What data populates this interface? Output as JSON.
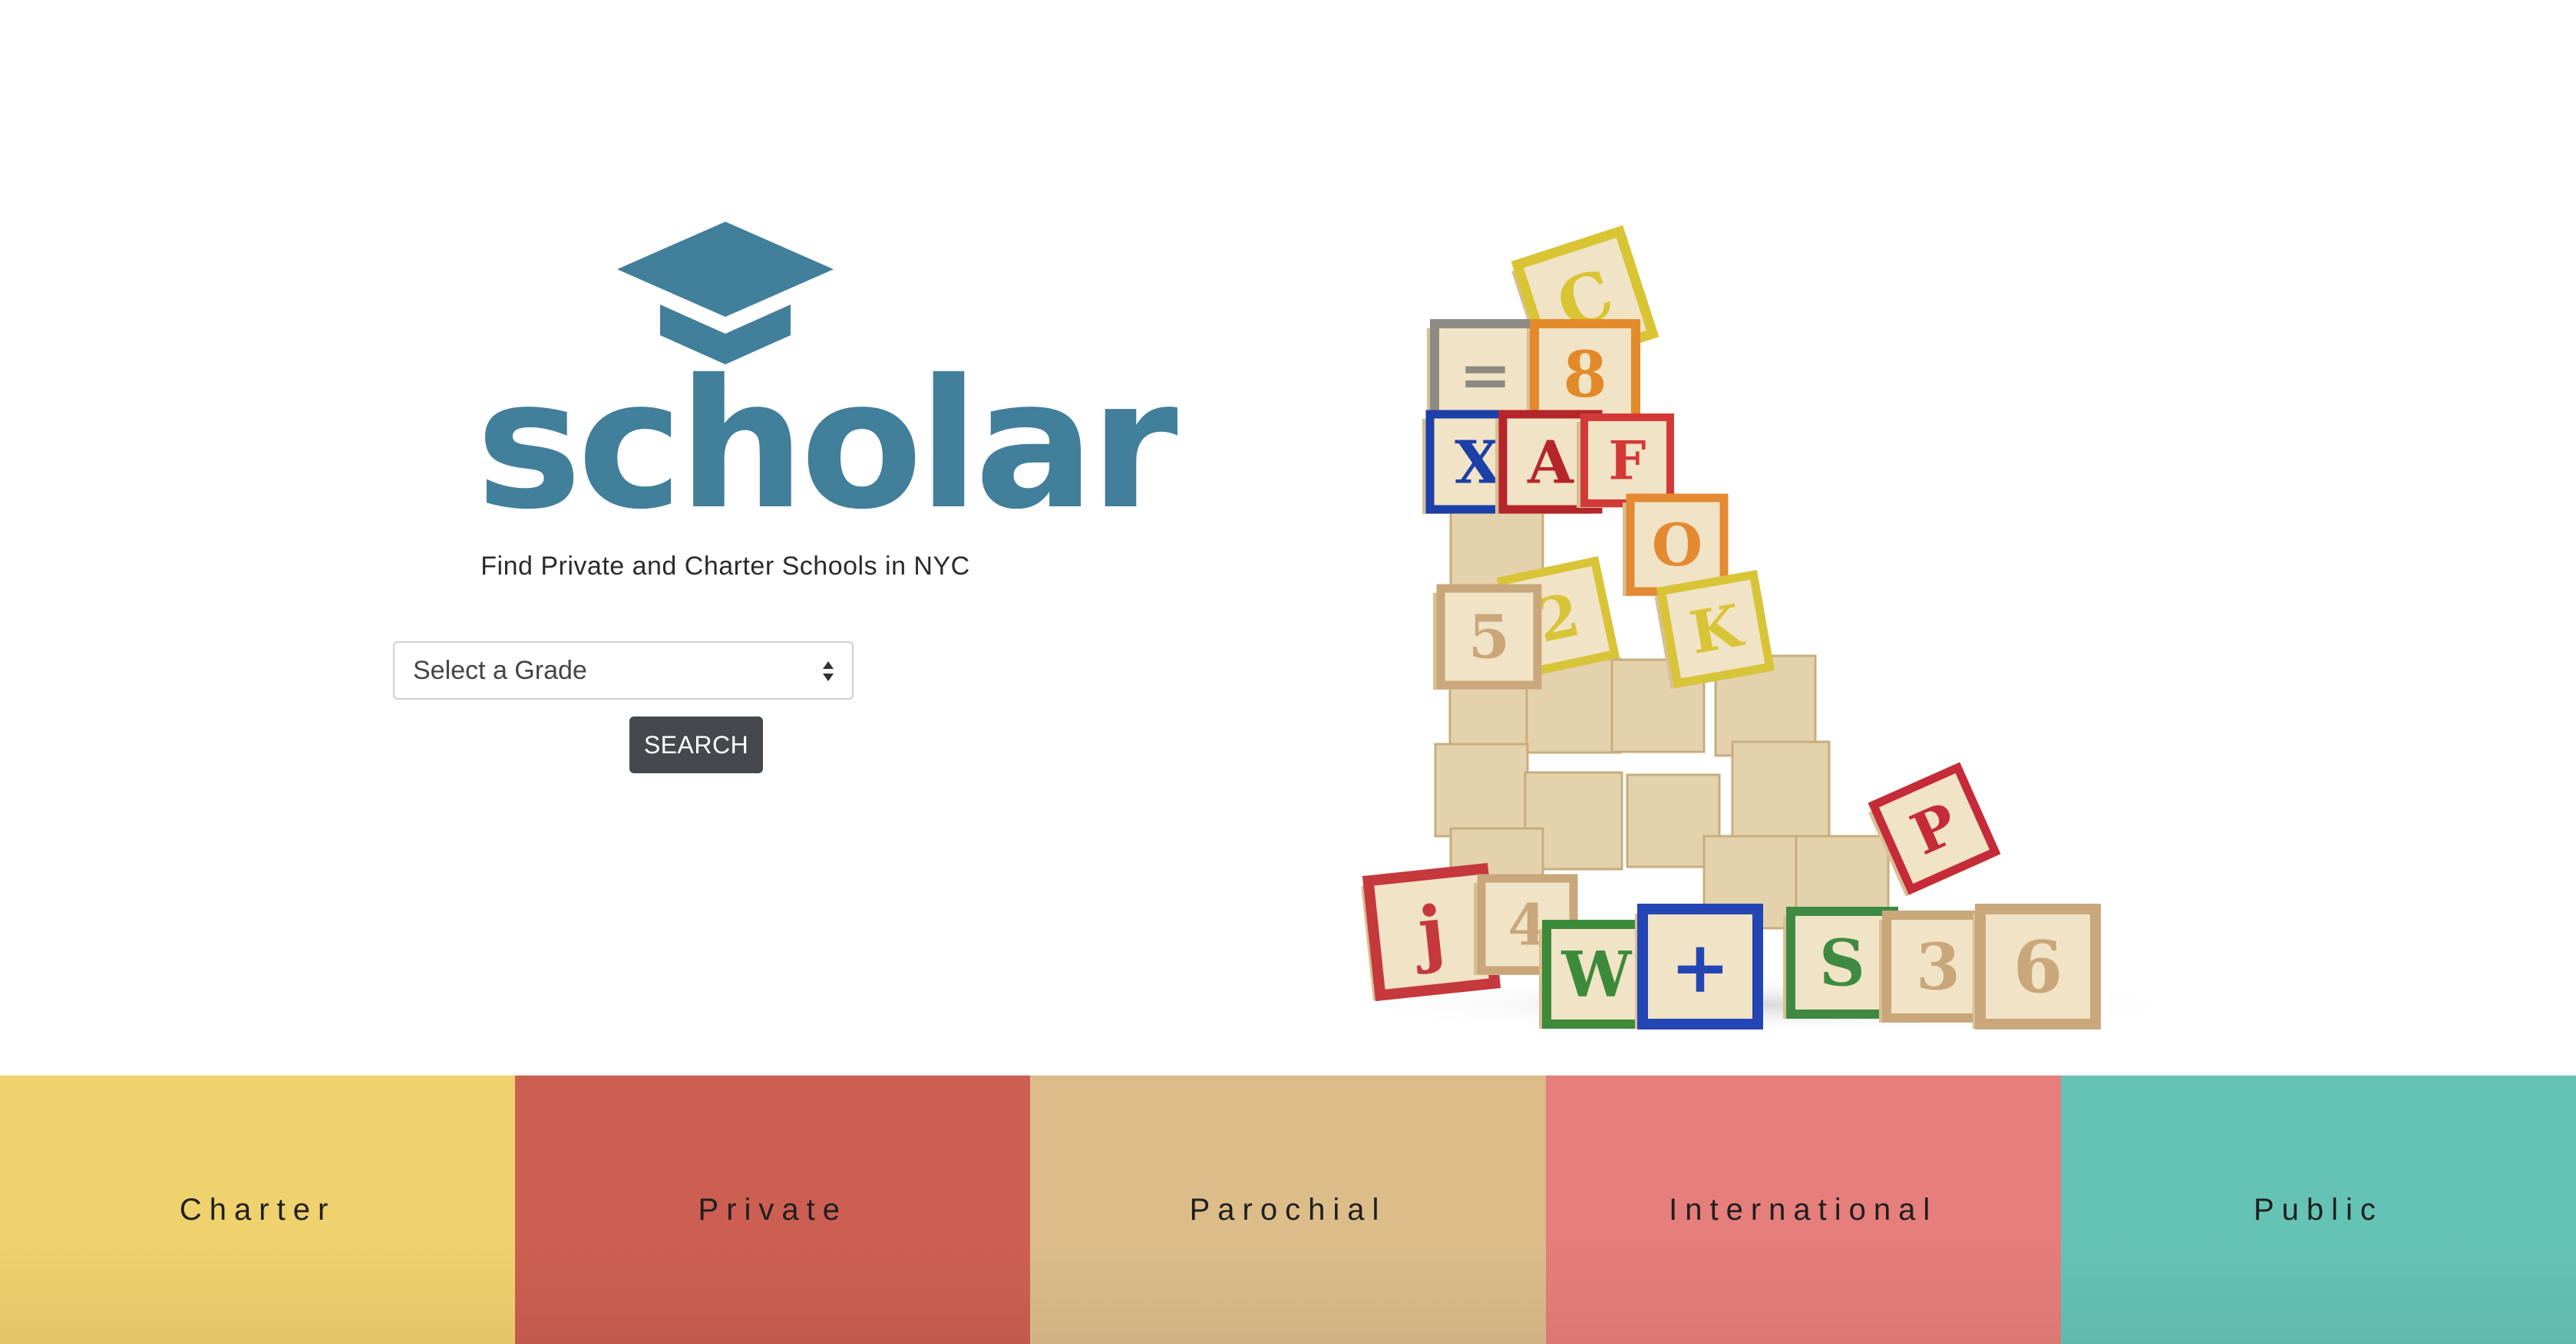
{
  "brand": {
    "name": "scholar",
    "tagline": "Find Private and Charter Schools in NYC",
    "color": "#417f9b",
    "icon": "graduation-cap-icon"
  },
  "search": {
    "select_value": "Select a Grade",
    "button_label": "SEARCH"
  },
  "hero_image": {
    "icon": "alphabet-blocks-image",
    "block_letters": [
      "C",
      "=",
      "8",
      "X",
      "A",
      "F",
      "O",
      "K",
      "2",
      "P",
      "j",
      "4",
      "W",
      "+",
      "S",
      "3",
      "6",
      "5"
    ]
  },
  "categories": [
    {
      "label": "Charter",
      "color": "#efd16d"
    },
    {
      "label": "Private",
      "color": "#cd5f52"
    },
    {
      "label": "Parochial",
      "color": "#dcbd8a"
    },
    {
      "label": "International",
      "color": "#e67e7b"
    },
    {
      "label": "Public",
      "color": "#65c3b6"
    }
  ]
}
